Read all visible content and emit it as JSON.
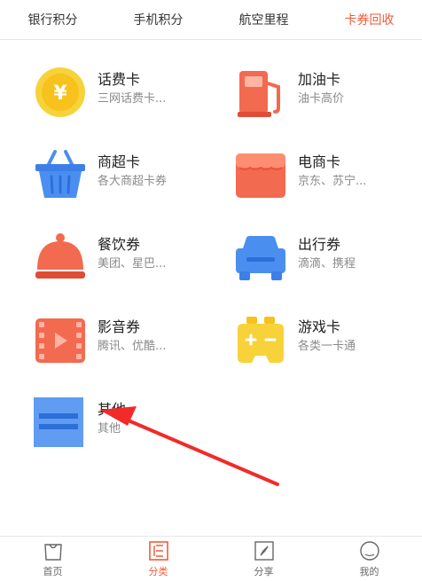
{
  "top_tabs": [
    {
      "label": "银行积分",
      "active": false
    },
    {
      "label": "手机积分",
      "active": false
    },
    {
      "label": "航空里程",
      "active": false
    },
    {
      "label": "卡券回收",
      "active": true
    }
  ],
  "cards": [
    {
      "title": "话费卡",
      "sub": "三网话费卡...",
      "icon": "coin-yen-icon"
    },
    {
      "title": "加油卡",
      "sub": "油卡高价",
      "icon": "fuel-pump-icon"
    },
    {
      "title": "商超卡",
      "sub": "各大商超卡券",
      "icon": "shopping-basket-icon"
    },
    {
      "title": "电商卡",
      "sub": "京东、苏宁...",
      "icon": "storefront-icon"
    },
    {
      "title": "餐饮券",
      "sub": "美团、星巴...",
      "icon": "food-cloche-icon"
    },
    {
      "title": "出行券",
      "sub": "滴滴、携程",
      "icon": "car-icon"
    },
    {
      "title": "影音券",
      "sub": "腾讯、优酷...",
      "icon": "video-film-icon"
    },
    {
      "title": "游戏卡",
      "sub": "各类一卡通",
      "icon": "gamepad-icon"
    },
    {
      "title": "其他",
      "sub": "其他",
      "icon": "other-card-icon"
    }
  ],
  "bottom_nav": [
    {
      "label": "首页",
      "icon": "bag-icon",
      "active": false
    },
    {
      "label": "分类",
      "icon": "category-icon",
      "active": true
    },
    {
      "label": "分享",
      "icon": "compass-share-icon",
      "active": false
    },
    {
      "label": "我的",
      "icon": "profile-circle-icon",
      "active": false
    }
  ],
  "colors": {
    "accent": "#f15a3a",
    "text": "#222222",
    "subtext": "#8a8a8a"
  }
}
